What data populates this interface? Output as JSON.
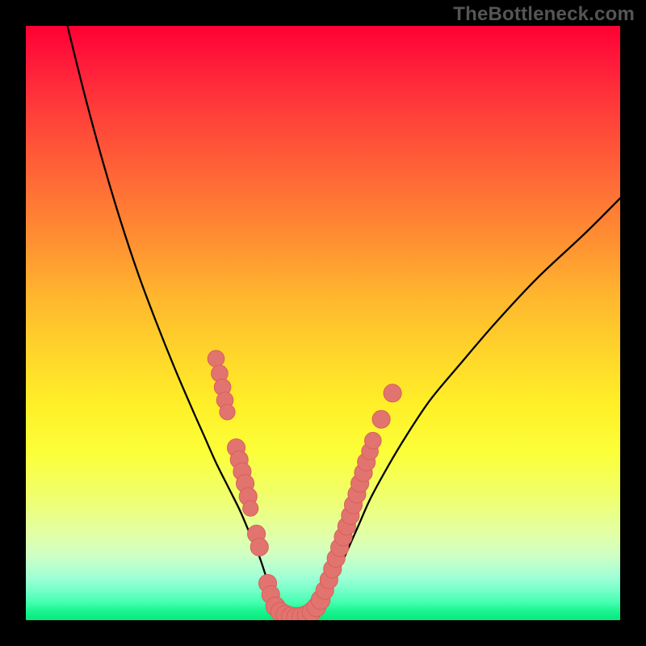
{
  "watermark": {
    "text": "TheBottleneck.com"
  },
  "colors": {
    "curve": "#000000",
    "marker_fill": "#e2746f",
    "marker_stroke": "#d85f59",
    "gradient_top": "#ff0033",
    "gradient_bottom": "#08e87d",
    "frame": "#000000"
  },
  "chart_data": {
    "type": "line",
    "title": "",
    "xlabel": "",
    "ylabel": "",
    "xlim": [
      0,
      100
    ],
    "ylim": [
      0,
      100
    ],
    "series": [
      {
        "name": "left-branch",
        "x": [
          7,
          10,
          13,
          16,
          19,
          22,
          25,
          28,
          30,
          32,
          34,
          36,
          37.5,
          39,
          40.2,
          41.2,
          42
        ],
        "y": [
          100,
          88,
          77,
          67,
          58,
          50,
          42.5,
          35.5,
          31,
          26.5,
          22.5,
          18.5,
          15,
          11.5,
          8,
          4.5,
          1.5
        ]
      },
      {
        "name": "valley-floor",
        "x": [
          42,
          43,
          44,
          45,
          46,
          47,
          48,
          49
        ],
        "y": [
          1.5,
          0.8,
          0.5,
          0.4,
          0.5,
          0.7,
          1.1,
          1.8
        ]
      },
      {
        "name": "right-branch",
        "x": [
          49,
          50.5,
          52,
          54,
          56,
          58,
          61,
          64,
          68,
          73,
          79,
          86,
          94,
          100
        ],
        "y": [
          1.8,
          4,
          7,
          11.5,
          16,
          20.5,
          26,
          31,
          37,
          43,
          50,
          57.5,
          65,
          71
        ]
      }
    ],
    "markers": [
      {
        "x": 32.0,
        "y": 44.0,
        "r": 1.4
      },
      {
        "x": 32.6,
        "y": 41.5,
        "r": 1.4
      },
      {
        "x": 33.1,
        "y": 39.2,
        "r": 1.4
      },
      {
        "x": 33.5,
        "y": 37.0,
        "r": 1.4
      },
      {
        "x": 33.9,
        "y": 35.0,
        "r": 1.3
      },
      {
        "x": 35.4,
        "y": 29.0,
        "r": 1.5
      },
      {
        "x": 35.9,
        "y": 27.0,
        "r": 1.5
      },
      {
        "x": 36.4,
        "y": 25.0,
        "r": 1.5
      },
      {
        "x": 36.9,
        "y": 23.0,
        "r": 1.5
      },
      {
        "x": 37.4,
        "y": 20.8,
        "r": 1.5
      },
      {
        "x": 37.8,
        "y": 18.8,
        "r": 1.3
      },
      {
        "x": 38.8,
        "y": 14.5,
        "r": 1.5
      },
      {
        "x": 39.3,
        "y": 12.3,
        "r": 1.5
      },
      {
        "x": 40.7,
        "y": 6.2,
        "r": 1.5
      },
      {
        "x": 41.2,
        "y": 4.3,
        "r": 1.5
      },
      {
        "x": 42.0,
        "y": 2.3,
        "r": 1.6
      },
      {
        "x": 42.8,
        "y": 1.4,
        "r": 1.6
      },
      {
        "x": 43.7,
        "y": 0.9,
        "r": 1.6
      },
      {
        "x": 44.6,
        "y": 0.6,
        "r": 1.6
      },
      {
        "x": 45.5,
        "y": 0.5,
        "r": 1.6
      },
      {
        "x": 46.4,
        "y": 0.6,
        "r": 1.6
      },
      {
        "x": 47.3,
        "y": 0.9,
        "r": 1.6
      },
      {
        "x": 48.1,
        "y": 1.4,
        "r": 1.6
      },
      {
        "x": 48.9,
        "y": 2.2,
        "r": 1.6
      },
      {
        "x": 49.6,
        "y": 3.4,
        "r": 1.6
      },
      {
        "x": 50.3,
        "y": 5.0,
        "r": 1.5
      },
      {
        "x": 51.0,
        "y": 6.8,
        "r": 1.5
      },
      {
        "x": 51.6,
        "y": 8.6,
        "r": 1.5
      },
      {
        "x": 52.2,
        "y": 10.4,
        "r": 1.5
      },
      {
        "x": 52.8,
        "y": 12.2,
        "r": 1.5
      },
      {
        "x": 53.4,
        "y": 14.0,
        "r": 1.5
      },
      {
        "x": 54.0,
        "y": 15.8,
        "r": 1.5
      },
      {
        "x": 54.6,
        "y": 17.6,
        "r": 1.5
      },
      {
        "x": 55.1,
        "y": 19.4,
        "r": 1.5
      },
      {
        "x": 55.7,
        "y": 21.2,
        "r": 1.5
      },
      {
        "x": 56.2,
        "y": 23.0,
        "r": 1.5
      },
      {
        "x": 56.8,
        "y": 24.8,
        "r": 1.5
      },
      {
        "x": 57.3,
        "y": 26.6,
        "r": 1.5
      },
      {
        "x": 57.9,
        "y": 28.4,
        "r": 1.4
      },
      {
        "x": 58.4,
        "y": 30.2,
        "r": 1.4
      },
      {
        "x": 59.8,
        "y": 33.8,
        "r": 1.5
      },
      {
        "x": 61.7,
        "y": 38.2,
        "r": 1.5
      }
    ]
  }
}
